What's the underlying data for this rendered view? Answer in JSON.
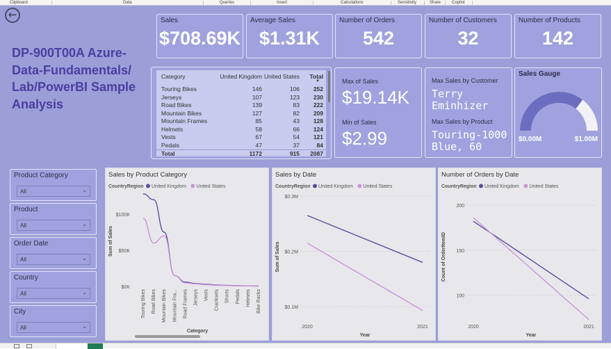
{
  "ribbon": {
    "groups": [
      "Clipboard",
      "Data",
      "Queries",
      "Insert",
      "Calculations",
      "Sensitivity",
      "Share",
      "Copilot"
    ]
  },
  "report_title": "DP-900T00A Azure-Data-Fundamentals/ Lab/PowerBI Sample Analysis",
  "kpis": [
    {
      "label": "Sales",
      "value": "$708.69K"
    },
    {
      "label": "Average Sales",
      "value": "$1.31K"
    },
    {
      "label": "Number of Orders",
      "value": "542"
    },
    {
      "label": "Number of Customers",
      "value": "32"
    },
    {
      "label": "Number of Products",
      "value": "142"
    }
  ],
  "matrix": {
    "headers": [
      "Category",
      "United Kingdom",
      "United States",
      "Total"
    ],
    "rows": [
      [
        "Touring Bikes",
        "146",
        "106",
        "252"
      ],
      [
        "Jerseys",
        "107",
        "123",
        "230"
      ],
      [
        "Road Bikes",
        "139",
        "83",
        "222"
      ],
      [
        "Mountain Bikes",
        "127",
        "82",
        "209"
      ],
      [
        "Mountain Frames",
        "85",
        "43",
        "128"
      ],
      [
        "Helmets",
        "58",
        "66",
        "124"
      ],
      [
        "Vests",
        "67",
        "54",
        "121"
      ],
      [
        "Pedals",
        "47",
        "37",
        "84"
      ]
    ],
    "total": [
      "Total",
      "1172",
      "915",
      "2087"
    ]
  },
  "maxmin": {
    "max_label": "Max of Sales",
    "max_value": "$19.14K",
    "min_label": "Min of Sales",
    "min_value": "$2.99"
  },
  "by_customer": {
    "cust_label": "Max Sales by Customer",
    "cust_value": "Terry Eminhizer",
    "prod_label": "Max Sales by Product",
    "prod_value": "Touring-1000 Blue, 60"
  },
  "gauge": {
    "title": "Sales Gauge",
    "min": "$0.00M",
    "max": "$1.00M",
    "fill_fraction": 0.7087
  },
  "slicers": [
    {
      "label": "Product Category",
      "value": "All"
    },
    {
      "label": "Product",
      "value": "All"
    },
    {
      "label": "Order Date",
      "value": "All"
    },
    {
      "label": "Country",
      "value": "All"
    },
    {
      "label": "City",
      "value": "All"
    }
  ],
  "colors": {
    "uk": "#5b4e9e",
    "us": "#c795d6"
  },
  "chart_data": [
    {
      "type": "line",
      "title": "Sales by Product Category",
      "legend_title": "CountryRegion",
      "legend_position": "top-left",
      "xlabel": "Category",
      "ylabel": "Sum of Sales",
      "categories": [
        "Touring Bikes",
        "Road Bikes",
        "Mountain Bikes",
        "Mountain Fra...",
        "Road Frames",
        "Jerseys",
        "Vests",
        "Cranksets",
        "Shorts",
        "Pedals",
        "Helmets",
        "Bike Racks"
      ],
      "yticks": [
        "$0K",
        "$50K",
        "$100K"
      ],
      "ylim": [
        0,
        125000
      ],
      "series": [
        {
          "name": "United Kingdom",
          "values": [
            128000,
            120000,
            75000,
            15000,
            6000,
            4000,
            3000,
            2000,
            1500,
            1000,
            800,
            600
          ]
        },
        {
          "name": "United States",
          "values": [
            94000,
            60000,
            70000,
            15000,
            5000,
            3500,
            2500,
            1500,
            1200,
            900,
            700,
            500
          ]
        }
      ]
    },
    {
      "type": "line",
      "title": "Sales by Date",
      "legend_title": "CountryRegion",
      "legend_position": "top-left",
      "xlabel": "Year",
      "ylabel": "Sum of Sales",
      "x": [
        "2020",
        "2021"
      ],
      "yticks": [
        "$0.1M",
        "$0.2M",
        "$0.3M"
      ],
      "ylim": [
        80000,
        300000
      ],
      "series": [
        {
          "name": "United Kingdom",
          "values": [
            265000,
            180000
          ]
        },
        {
          "name": "United States",
          "values": [
            215000,
            93000
          ]
        }
      ]
    },
    {
      "type": "line",
      "title": "Number of Orders by Date",
      "legend_title": "CountryRegion",
      "legend_position": "top-left",
      "xlabel": "Year",
      "ylabel": "Count of OrderItemID",
      "x": [
        "2020",
        "2021"
      ],
      "yticks": [
        "100",
        "150",
        "200"
      ],
      "ylim": [
        75,
        210
      ],
      "series": [
        {
          "name": "United Kingdom",
          "values": [
            182,
            96
          ]
        },
        {
          "name": "United States",
          "values": [
            186,
            73
          ]
        }
      ]
    }
  ]
}
